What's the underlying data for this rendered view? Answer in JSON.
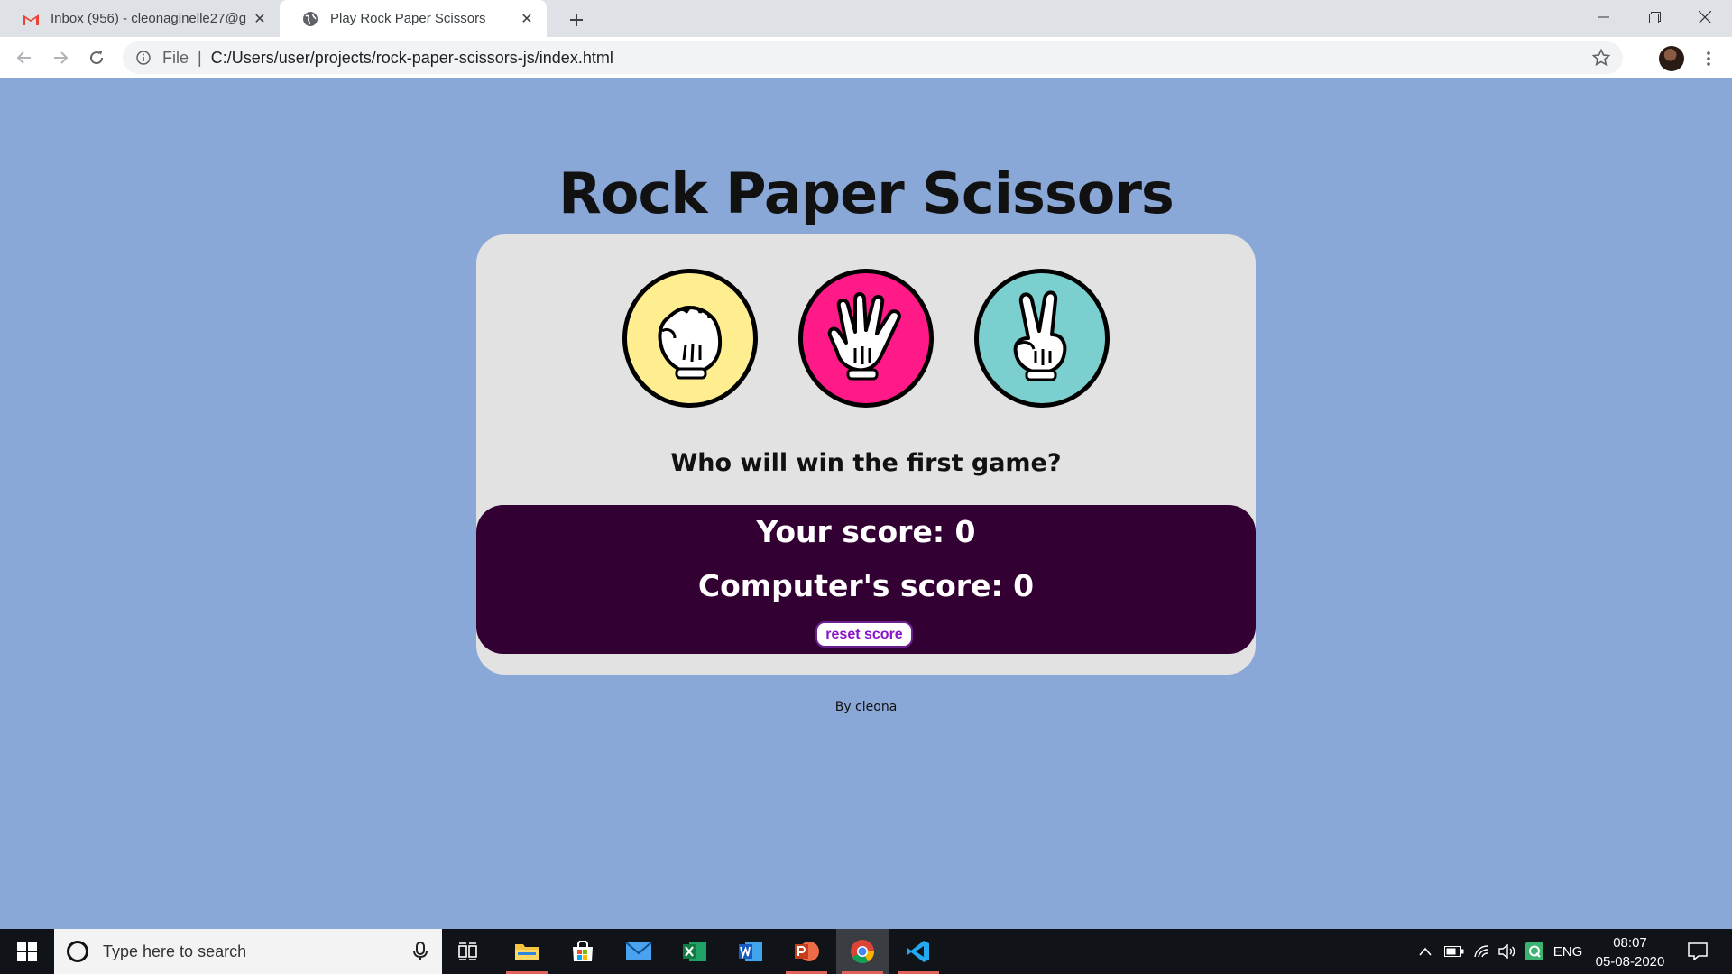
{
  "browser": {
    "tabs": [
      {
        "title": "Inbox (956) - cleonaginelle27@g",
        "icon": "gmail-icon"
      },
      {
        "title": "Play Rock Paper Scissors",
        "icon": "globe-icon"
      }
    ],
    "address": {
      "scheme": "File",
      "url": "C:/Users/user/projects/rock-paper-scissors-js/index.html"
    }
  },
  "game": {
    "title": "Rock Paper Scissors",
    "choices": [
      {
        "name": "rock",
        "color": "#ffee90"
      },
      {
        "name": "paper",
        "color": "#ff1a88"
      },
      {
        "name": "scissors",
        "color": "#7ccfcf"
      }
    ],
    "prompt": "Who will win the first game?",
    "your_score": "Your score: 0",
    "computer_score": "Computer's score: 0",
    "reset_label": "reset score",
    "byline": "By cleona"
  },
  "taskbar": {
    "search_placeholder": "Type here to search",
    "language": "ENG",
    "time": "08:07",
    "date": "05-08-2020",
    "apps": [
      "task-view",
      "file-explorer",
      "store",
      "mail",
      "excel",
      "word",
      "powerpoint",
      "chrome",
      "vscode"
    ]
  },
  "colors": {
    "page_background": "#8aa8d7",
    "card_background": "#e2e2e2",
    "scorebox_background": "#330033",
    "reset_text": "#8a14c8"
  }
}
